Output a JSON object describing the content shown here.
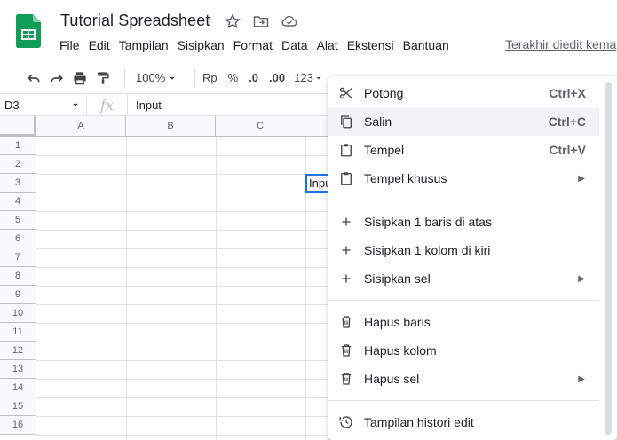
{
  "app": {
    "title": "Tutorial Spreadsheet",
    "last_edit": "Terakhir diedit kema",
    "menu": [
      "File",
      "Edit",
      "Tampilan",
      "Sisipkan",
      "Format",
      "Data",
      "Alat",
      "Ekstensi",
      "Bantuan"
    ]
  },
  "toolbar": {
    "zoom": "100%",
    "currency": "Rp",
    "percent": "%",
    "dec_decrease": ".0",
    "dec_increase": ".00",
    "number_format": "123"
  },
  "formula_bar": {
    "cell_ref": "D3",
    "fx": "fx",
    "value": "Input"
  },
  "grid": {
    "columns": [
      "A",
      "B",
      "C"
    ],
    "rows": [
      "1",
      "2",
      "3",
      "4",
      "5",
      "6",
      "7",
      "8",
      "9",
      "10",
      "11",
      "12",
      "13",
      "14",
      "15",
      "16"
    ],
    "active_cell_text": "Input"
  },
  "context_menu": {
    "items": [
      {
        "label": "Potong",
        "shortcut": "Ctrl+X",
        "icon": "scissors-icon"
      },
      {
        "label": "Salin",
        "shortcut": "Ctrl+C",
        "icon": "copy-icon"
      },
      {
        "label": "Tempel",
        "shortcut": "Ctrl+V",
        "icon": "clipboard-icon"
      },
      {
        "label": "Tempel khusus",
        "icon": "clipboard-icon"
      },
      {
        "label": "Sisipkan 1 baris di atas",
        "icon": "plus-icon"
      },
      {
        "label": "Sisipkan 1 kolom di kiri",
        "icon": "plus-icon"
      },
      {
        "label": "Sisipkan sel",
        "icon": "plus-icon"
      },
      {
        "label": "Hapus baris",
        "icon": "trash-icon"
      },
      {
        "label": "Hapus kolom",
        "icon": "trash-icon"
      },
      {
        "label": "Hapus sel",
        "icon": "trash-icon"
      },
      {
        "label": "Tampilan histori edit",
        "icon": "history-icon"
      }
    ],
    "highlight_color": "#f1f3f4"
  },
  "colors": {
    "brand_green": "#0f9d58",
    "selection_blue": "#1a73e8"
  }
}
